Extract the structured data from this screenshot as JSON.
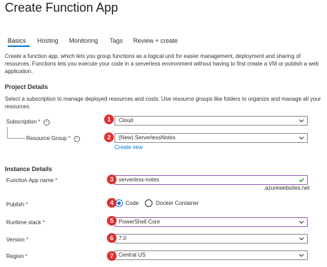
{
  "page": {
    "title": "Create Function App"
  },
  "tabs": [
    {
      "label": "Basics",
      "active": true
    },
    {
      "label": "Hosting"
    },
    {
      "label": "Monitoring"
    },
    {
      "label": "Tags"
    },
    {
      "label": "Review + create"
    }
  ],
  "intro": "Create a function app, which lets you group functions as a logical unit for easier management, deployment and sharing of resources. Functions lets you execute your code in a serverless environment without having to first create a VM or publish a web application.",
  "project": {
    "heading": "Project Details",
    "description": "Select a subscription to manage deployed resources and costs. Use resource groups like folders to organize and manage all your resources.",
    "subscription_label": "Subscription",
    "subscription_value": "Cloud",
    "resource_group_label": "Resource Group",
    "resource_group_value": "(New) ServerlessNotes",
    "create_new": "Create new"
  },
  "instance": {
    "heading": "Instance Details",
    "name_label": "Function App name",
    "name_value": "serverless-notes",
    "name_suffix": ".azurewebsites.net",
    "publish_label": "Publish",
    "publish_options": [
      "Code",
      "Docker Container"
    ],
    "publish_selected": "Code",
    "runtime_label": "Runtime stack",
    "runtime_value": "PowerShell Core",
    "version_label": "Version",
    "version_value": "7.0",
    "region_label": "Region",
    "region_value": "Central US"
  },
  "required_marker": "*",
  "badges": [
    "1",
    "2",
    "3",
    "4",
    "5",
    "6",
    "7"
  ],
  "colors": {
    "accent": "#0078d4",
    "badge": "#e03030",
    "highlight": "#9b58b5",
    "valid": "#107c10",
    "required": "#a4262c"
  }
}
